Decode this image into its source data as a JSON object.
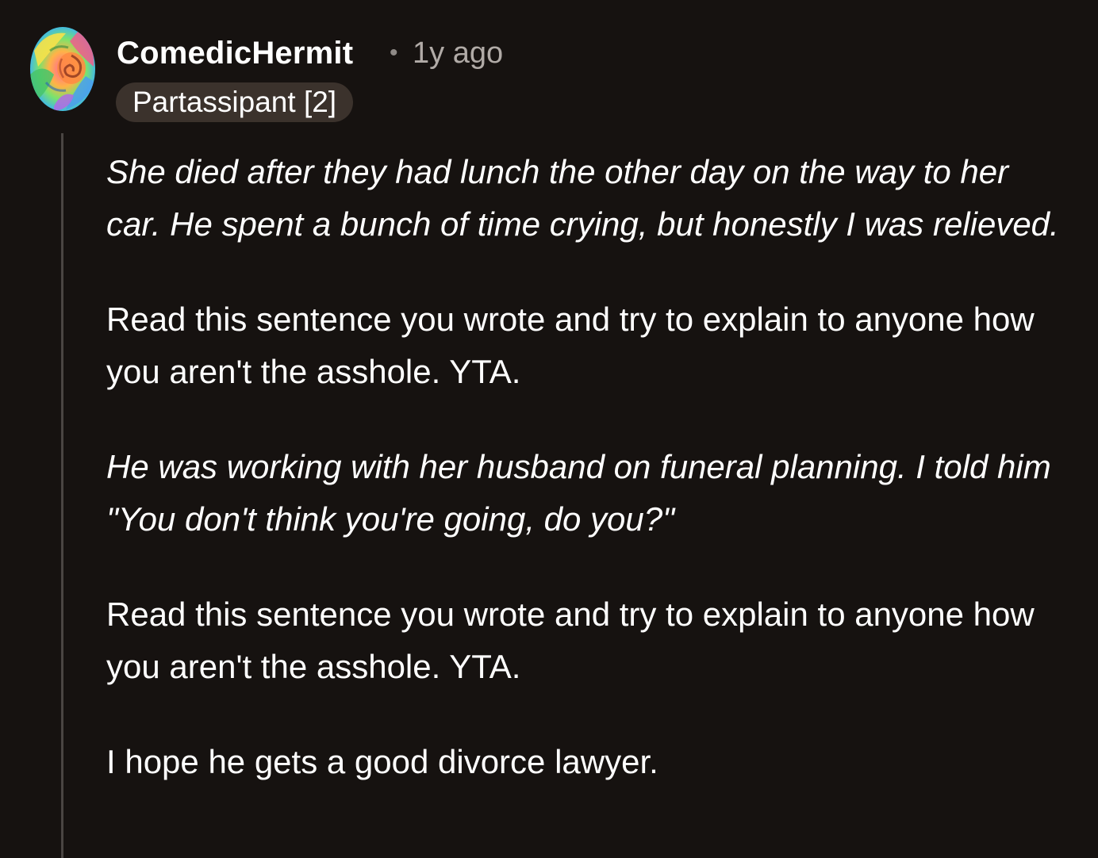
{
  "comment": {
    "author": "ComedicHermit",
    "separator": "•",
    "time_ago": "1y ago",
    "flair": "Partassipant [2]",
    "avatar_icon": "rainbow-rose-avatar",
    "paragraphs": [
      {
        "style": "italic",
        "text": "She died after they had lunch the other day on the way to her car. He spent a bunch of time crying, but honestly I was relieved."
      },
      {
        "style": "normal",
        "text": "Read this sentence you wrote and try to explain to anyone how you aren't the asshole. YTA."
      },
      {
        "style": "italic",
        "text": "He was working with her husband on funeral planning. I told him \"You don't think you're going, do you?\""
      },
      {
        "style": "normal",
        "text": "Read this sentence you wrote and try to explain to anyone how you aren't the asshole. YTA."
      },
      {
        "style": "normal",
        "text": "I hope he gets a good divorce lawyer."
      }
    ]
  },
  "colors": {
    "background": "#161210",
    "flair_bg": "#3b322c",
    "thread_line": "#4a4542",
    "timestamp": "#b1aba7"
  }
}
